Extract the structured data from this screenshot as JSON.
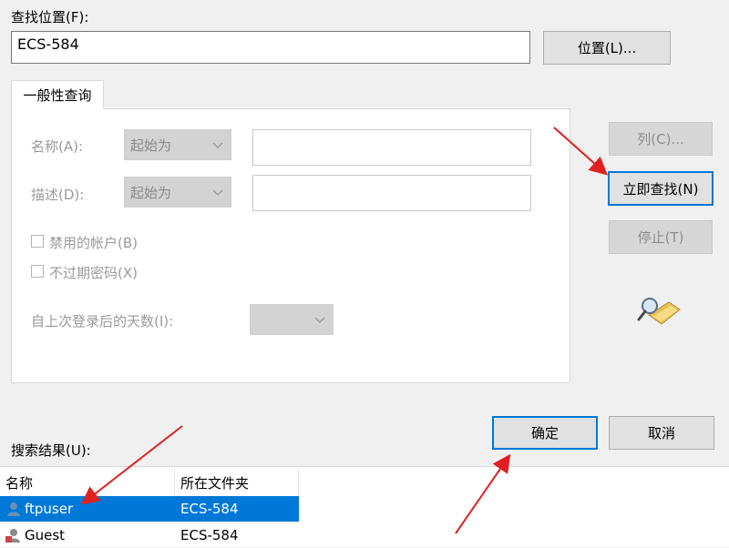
{
  "location": {
    "label": "查找位置(F):",
    "value": "ECS-584",
    "button_label": "位置(L)..."
  },
  "tab": {
    "label": "一般性查询"
  },
  "query": {
    "name_label": "名称(A):",
    "name_condition": "起始为",
    "desc_label": "描述(D):",
    "desc_condition": "起始为",
    "disabled_accounts_label": "禁用的帐户(B)",
    "non_expiring_pw_label": "不过期密码(X)",
    "days_since_login_label": "自上次登录后的天数(I):"
  },
  "side_buttons": {
    "columns_label": "列(C)...",
    "find_now_label": "立即查找(N)",
    "stop_label": "停止(T)"
  },
  "dialog_buttons": {
    "ok_label": "确定",
    "cancel_label": "取消"
  },
  "results": {
    "label": "搜索结果(U):",
    "columns": [
      "名称",
      "所在文件夹"
    ],
    "rows": [
      {
        "name": "ftpuser",
        "folder": "ECS-584",
        "selected": true
      },
      {
        "name": "Guest",
        "folder": "ECS-584",
        "selected": false
      }
    ]
  },
  "colors": {
    "accent": "#0078d7",
    "annotation_arrow": "#e02020",
    "window_bg": "#f0f0f0"
  },
  "icons": [
    "search-folder-icon",
    "user-icon",
    "chevron-down-icon"
  ]
}
